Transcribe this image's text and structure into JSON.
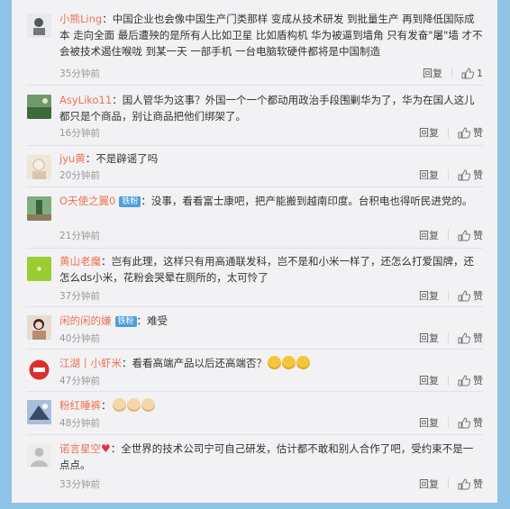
{
  "labels": {
    "reply": "回复",
    "like": "赞"
  },
  "comments": [
    {
      "user": "小熊Ling",
      "text": "中国企业也会像中国生产门类那样 变成从技术研发 到批量生产 再到降低国际成本 走向全面 最后遭殃的是所有人比如卫星 比如盾构机 华为被逼到墙角 只有发奋\"屠\"墙 才不会被技术遏住喉咙 到某一天 一部手机 一台电脑软硬件都将是中国制造",
      "time": "35分钟前",
      "likes": "1",
      "avatar_color": "#dfe3e8"
    },
    {
      "user": "AsyLiko11",
      "text": "国人管华为这事？外国一个一个都动用政治手段围剿华为了，华为在国人这儿都只是个商品，别让商品把他们绑架了。",
      "time": "16分钟前",
      "like_label": "赞",
      "avatar_color": "#5c8a5a"
    },
    {
      "user": "jyu黄",
      "text": "不是辟谣了吗",
      "time": "20分钟前",
      "like_label": "赞",
      "avatar_color": "#e9dccb"
    },
    {
      "user": "O天使之翼0",
      "badge": "铁粉",
      "text": "没事，看看富士康吧，把产能搬到越南印度。台积电也得听民进党的。",
      "time": "21分钟前",
      "like_label": "赞",
      "avatar_color": "#4d7a52"
    },
    {
      "user": "黄山老魔",
      "text": "岂有此理，这样只有用高通联发科，岂不是和小米一样了，还怎么打爱国牌，还怎么ds小米，花粉会哭晕在厕所的，太可怜了",
      "time": "37分钟前",
      "like_label": "赞",
      "avatar_color": "#9acd32"
    },
    {
      "user": "闲的闲的嫌",
      "badge": "铁粉",
      "text": "难受",
      "time": "40分钟前",
      "like_label": "赞",
      "avatar_color": "#c9b6a6"
    },
    {
      "user": "江湖丨小虾米",
      "text": "看看高端产品以后还高端否？",
      "emoji_count": 3,
      "emoji": "doge",
      "time": "47分钟前",
      "like_label": "赞",
      "avatar_color": "#d94040"
    },
    {
      "user": "粉红睡裤",
      "text": "",
      "emoji_count": 3,
      "emoji": "cat",
      "time": "48分钟前",
      "like_label": "赞",
      "avatar_color": "#7a9cc7"
    },
    {
      "user": "诺言星空",
      "text": "全世界的技术公司宁可自己研发，估计都不敢和别人合作了吧，受约束不是一点点。",
      "time": "33分钟前",
      "like_label": "赞",
      "avatar_color": "#e8e8e8",
      "has_heart_badge": true
    }
  ]
}
